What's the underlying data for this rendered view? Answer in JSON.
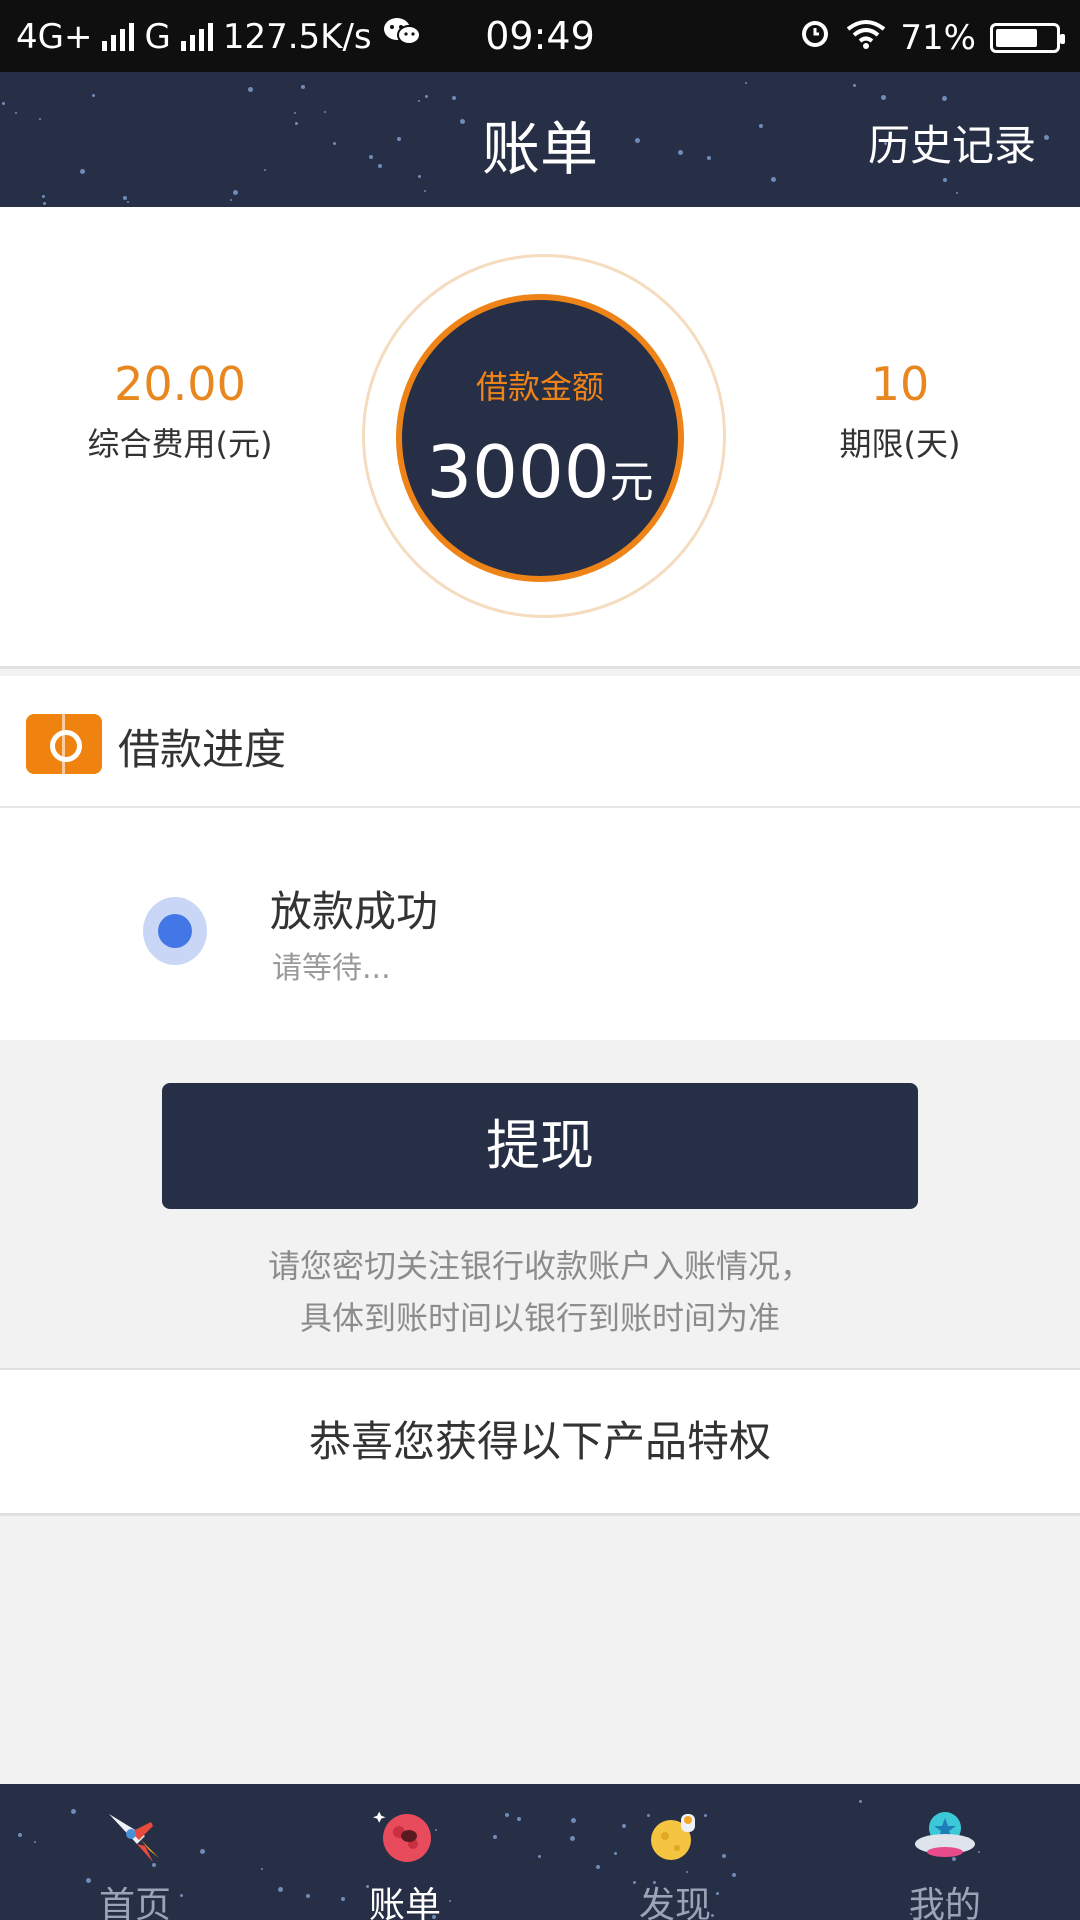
{
  "status_bar": {
    "network": "4G+",
    "network2": "G",
    "speed": "127.5K/s",
    "time": "09:49",
    "battery": "71%",
    "battery_level": 0.71
  },
  "header": {
    "title": "账单",
    "history": "历史记录"
  },
  "summary": {
    "fee_value": "20.00",
    "fee_label": "综合费用(元)",
    "loan_label": "借款金额",
    "loan_amount": "3000",
    "loan_unit": "元",
    "term_value": "10",
    "term_label": "期限(天)"
  },
  "progress": {
    "title": "借款进度",
    "status": "放款成功",
    "sub": "请等待..."
  },
  "withdraw": {
    "label": "提现"
  },
  "notice": {
    "line1": "请您密切关注银行收款账户入账情况，",
    "line2": "具体到账时间以银行到账时间为准"
  },
  "privilege": {
    "text": "恭喜您获得以下产品特权"
  },
  "tabs": [
    {
      "label": "首页",
      "icon": "rocket-icon"
    },
    {
      "label": "账单",
      "icon": "planet-icon",
      "active": true
    },
    {
      "label": "发现",
      "icon": "moon-icon"
    },
    {
      "label": "我的",
      "icon": "ufo-icon"
    }
  ],
  "colors": {
    "navy": "#262f45",
    "orange": "#ee8418",
    "blue_dot": "#4377e6"
  }
}
